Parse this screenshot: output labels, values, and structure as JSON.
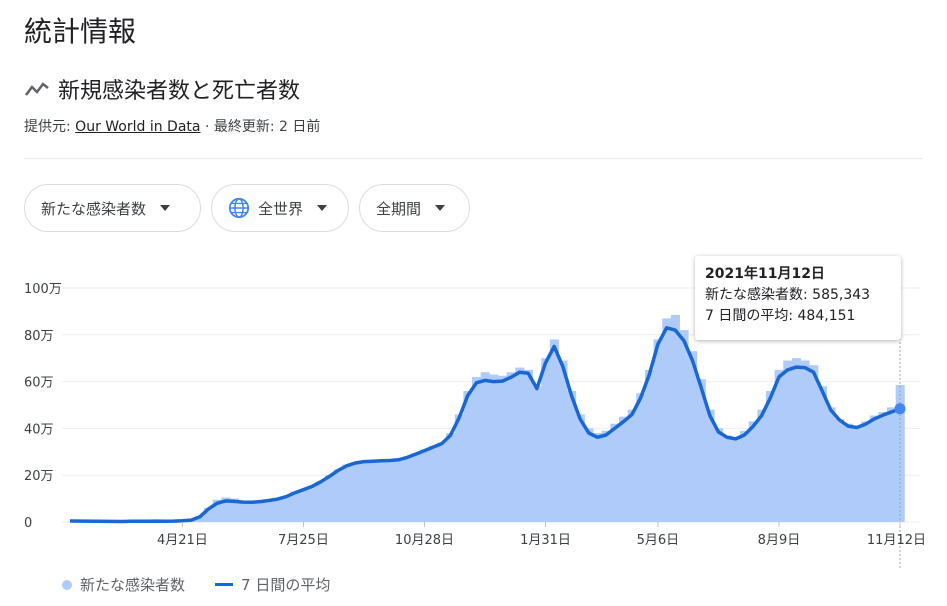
{
  "header": {
    "title": "統計情報"
  },
  "chart_header": {
    "title": "新規感染者数と死亡者数",
    "source_prefix": "提供元:",
    "source_name": "Our World in Data",
    "updated": "· 最終更新: 2 日前"
  },
  "filters": {
    "metric": "新たな感染者数",
    "region": "全世界",
    "period": "全期間"
  },
  "tooltip": {
    "date": "2021年11月12日",
    "cases_line": "新たな感染者数: 585,343",
    "avg_line": "7 日間の平均: 484,151"
  },
  "legend": {
    "cases": "新たな感染者数",
    "average": "7 日間の平均"
  },
  "colors": {
    "bars": "#aecbfa",
    "line": "#1967d2",
    "grid": "#eeeeee",
    "axis_text": "#3c4043"
  },
  "icons": {
    "trend": "trending-line-icon",
    "globe": "globe-icon",
    "dropdown": "caret-down-icon"
  },
  "chart_data": {
    "type": "bar",
    "ylim": [
      0,
      1000000
    ],
    "y_ticks": [
      {
        "value": 0,
        "label": "0"
      },
      {
        "value": 200000,
        "label": "20万"
      },
      {
        "value": 400000,
        "label": "40万"
      },
      {
        "value": 600000,
        "label": "60万"
      },
      {
        "value": 800000,
        "label": "80万"
      },
      {
        "value": 1000000,
        "label": "100万"
      }
    ],
    "x_ticks": [
      {
        "index": 13,
        "label": "4月21日"
      },
      {
        "index": 27,
        "label": "7月25日"
      },
      {
        "index": 41,
        "label": "10月28日"
      },
      {
        "index": 55,
        "label": "1月31日"
      },
      {
        "index": 68,
        "label": "5月6日"
      },
      {
        "index": 82,
        "label": "8月9日"
      },
      {
        "index": 96,
        "label": "11月12日"
      }
    ],
    "grid": true,
    "series": [
      {
        "name": "新たな感染者数",
        "type": "bar",
        "values": [
          2000,
          3000,
          4000,
          3500,
          5000,
          3000,
          4000,
          5000,
          8000,
          25000,
          60000,
          95000,
          105000,
          100000,
          90000,
          85000,
          90000,
          95000,
          100000,
          110000,
          130000,
          140000,
          155000,
          175000,
          200000,
          225000,
          245000,
          255000,
          260000,
          265000,
          265000,
          265000,
          270000,
          280000,
          295000,
          310000,
          325000,
          340000,
          380000,
          460000,
          560000,
          620000,
          640000,
          630000,
          625000,
          640000,
          660000,
          650000,
          580000,
          700000,
          780000,
          690000,
          560000,
          460000,
          400000,
          380000,
          390000,
          420000,
          450000,
          480000,
          550000,
          650000,
          780000,
          870000,
          885000,
          820000,
          730000,
          610000,
          480000,
          400000,
          370000,
          360000,
          390000,
          430000,
          480000,
          560000,
          650000,
          690000,
          700000,
          690000,
          670000,
          580000,
          490000,
          440000,
          420000,
          410000,
          430000,
          455000,
          470000,
          490000,
          585343
        ],
        "x_start": 6
      },
      {
        "name": "7 日間の平均",
        "type": "line",
        "values": [
          2000,
          3000,
          3500,
          3500,
          4000,
          3500,
          4000,
          5000,
          8000,
          22000,
          55000,
          80000,
          90000,
          88000,
          85000,
          84000,
          87000,
          92000,
          98000,
          108000,
          125000,
          138000,
          152000,
          172000,
          195000,
          220000,
          240000,
          252000,
          258000,
          260000,
          262000,
          263000,
          266000,
          276000,
          290000,
          305000,
          320000,
          335000,
          370000,
          445000,
          540000,
          595000,
          605000,
          600000,
          602000,
          618000,
          640000,
          636000,
          570000,
          680000,
          750000,
          665000,
          540000,
          440000,
          380000,
          362000,
          372000,
          400000,
          428000,
          460000,
          530000,
          630000,
          760000,
          830000,
          820000,
          775000,
          690000,
          575000,
          455000,
          385000,
          362000,
          355000,
          372000,
          408000,
          455000,
          530000,
          620000,
          650000,
          662000,
          660000,
          640000,
          560000,
          478000,
          436000,
          410000,
          404000,
          418000,
          440000,
          456000,
          470000,
          484151
        ],
        "x_start": 6
      }
    ]
  }
}
